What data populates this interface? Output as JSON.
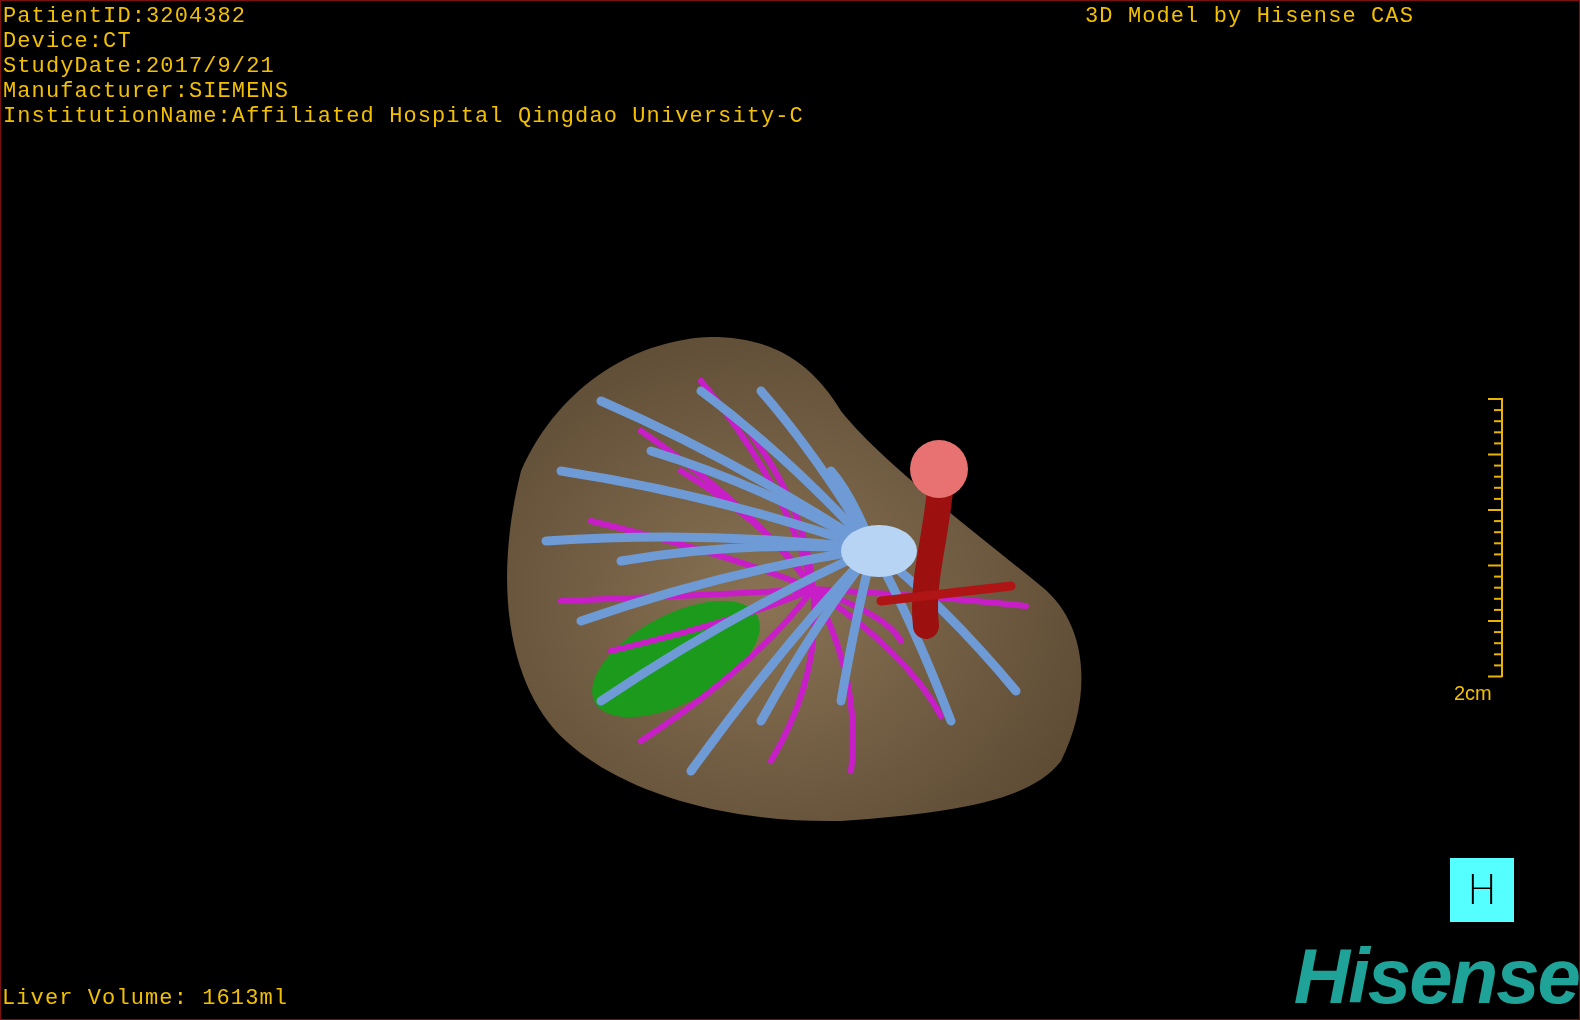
{
  "study_info": [
    "PatientID:3204382",
    "Device:CT",
    "StudyDate:2017/9/21",
    "Manufacturer:SIEMENS",
    "InstitutionName:Affiliated Hospital Qingdao University-C"
  ],
  "title": "3D Model by Hisense CAS",
  "scale_bar": {
    "label": "2cm"
  },
  "view_button": {
    "label": "H"
  },
  "liver_volume": "Liver Volume: 1613ml",
  "logo": "Hisense"
}
